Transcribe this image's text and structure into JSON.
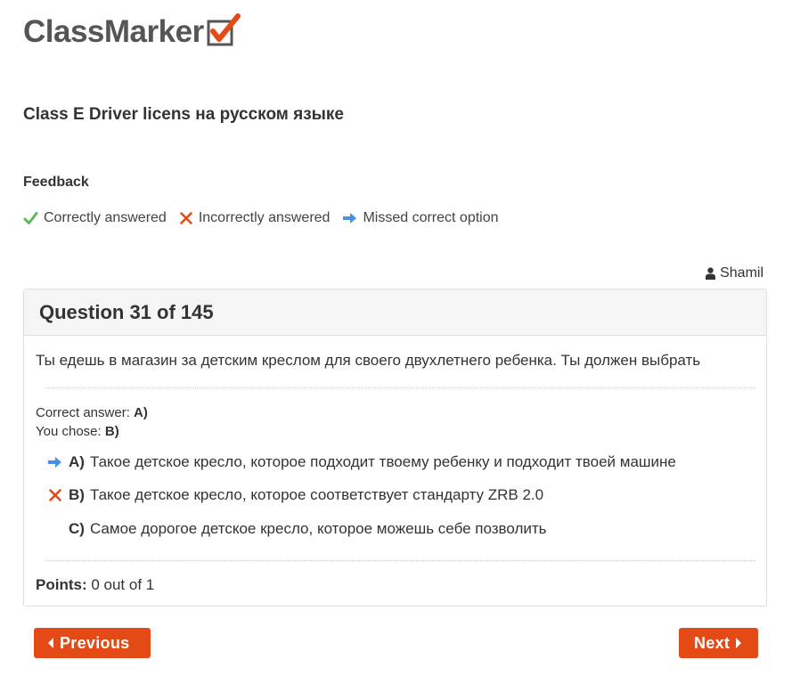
{
  "logo": {
    "text": "ClassMarker",
    "accent_color": "#e44a15"
  },
  "test_title": "Class E Driver licens на русском языке",
  "feedback": {
    "heading": "Feedback",
    "legend": [
      {
        "icon": "check-icon",
        "label": "Correctly answered",
        "color": "#5cb85c"
      },
      {
        "icon": "cross-icon",
        "label": "Incorrectly answered",
        "color": "#e44a15"
      },
      {
        "icon": "arrow-right-icon",
        "label": "Missed correct option",
        "color": "#4a90e2"
      }
    ]
  },
  "user": {
    "icon": "user-icon",
    "name": "Shamil"
  },
  "question": {
    "title": "Question 31 of 145",
    "text": "Ты едешь в магазин за детским креслом для своего двухлетнего ребенка. Ты должен выбрать",
    "correct_answer_label": "Correct answer:",
    "correct_answer_value": "A)",
    "you_chose_label": "You chose:",
    "you_chose_value": "B)",
    "options": [
      {
        "letter": "A)",
        "text": "Такое детское кресло, которое подходит твоему ребенку и подходит твоей машине",
        "mark": "arrow-right-icon"
      },
      {
        "letter": "B)",
        "text": "Такое детское кресло, которое соответствует стандарту ZRB 2.0",
        "mark": "cross-icon"
      },
      {
        "letter": "C)",
        "text": "Самое дорогое детское кресло, которое можешь себе позволить",
        "mark": ""
      }
    ],
    "points_label": "Points:",
    "points_value": "0 out of 1"
  },
  "nav": {
    "previous_label": "Previous",
    "next_label": "Next"
  },
  "colors": {
    "button": "#e44a15",
    "panel_header": "#f5f5f5",
    "border": "#dddddd"
  }
}
